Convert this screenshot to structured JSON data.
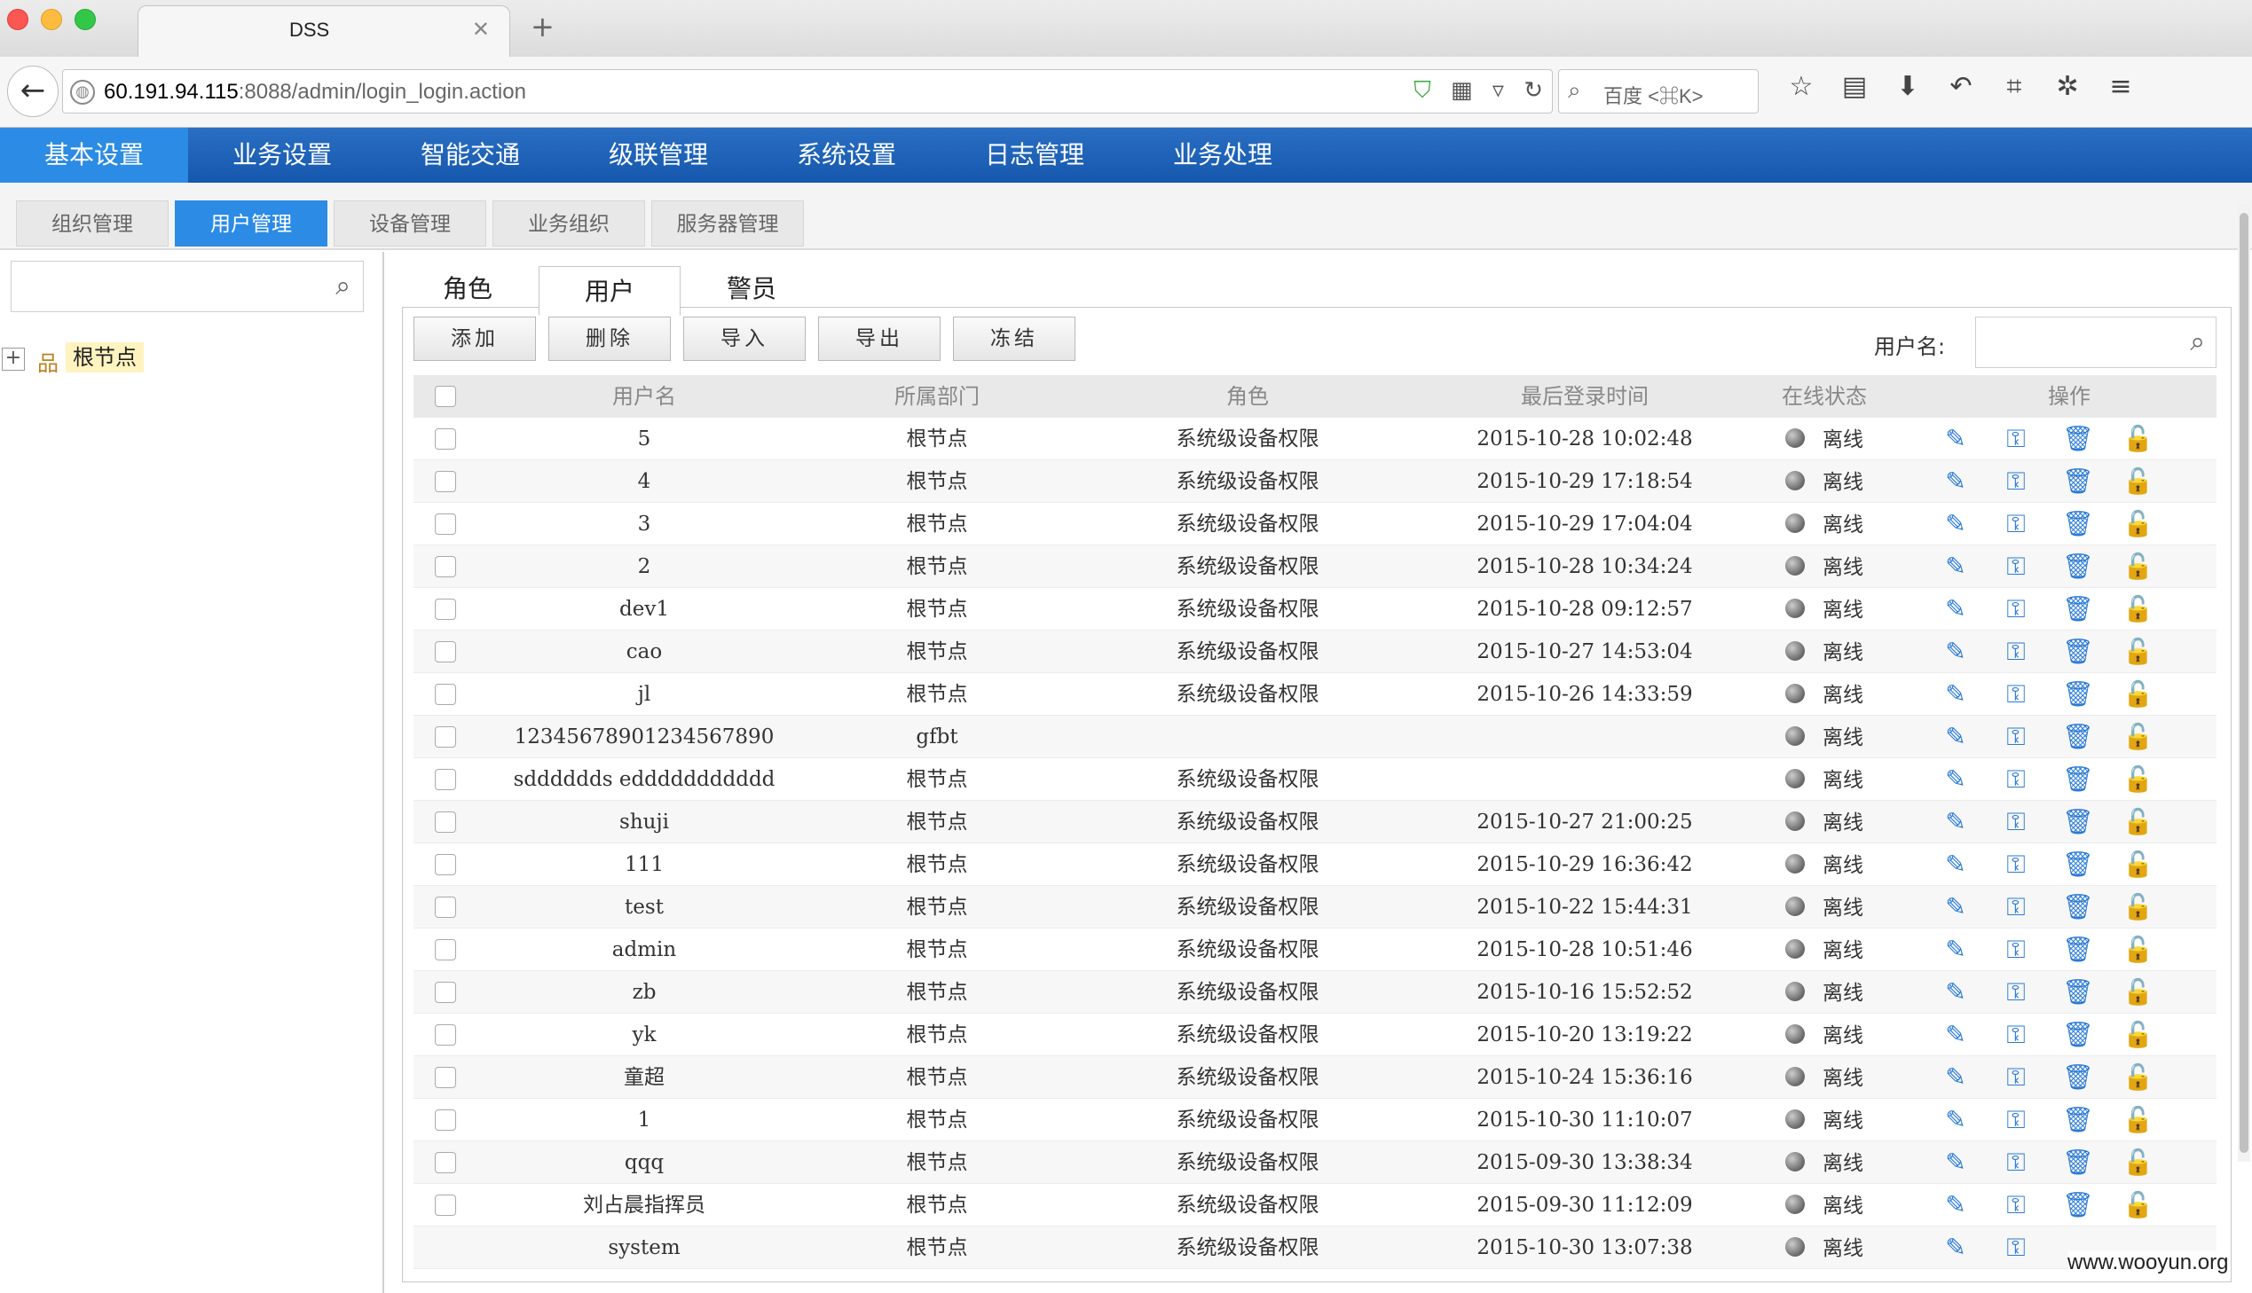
{
  "browser": {
    "tab_title": "DSS",
    "url_host": "60.191.94.115",
    "url_path": ":8088/admin/login_login.action",
    "search_placeholder": "百度 <⌘K>"
  },
  "mainnav": {
    "items": [
      "基本设置",
      "业务设置",
      "智能交通",
      "级联管理",
      "系统设置",
      "日志管理",
      "业务处理"
    ],
    "active_index": 0
  },
  "subnav": {
    "items": [
      "组织管理",
      "用户管理",
      "设备管理",
      "业务组织",
      "服务器管理"
    ],
    "active_index": 1
  },
  "tree": {
    "root_label": "根节点"
  },
  "inner_tabs": {
    "items": [
      "角色",
      "用户",
      "警员"
    ],
    "active_index": 1
  },
  "toolbar": {
    "add": "添加",
    "delete": "删除",
    "import": "导入",
    "export": "导出",
    "freeze": "冻结",
    "username_label": "用户名:"
  },
  "grid": {
    "headers": {
      "username": "用户名",
      "dept": "所属部门",
      "role": "角色",
      "last_login": "最后登录时间",
      "status": "在线状态",
      "ops": "操作"
    },
    "rows": [
      {
        "username": "5",
        "dept": "根节点",
        "role": "系统级设备权限",
        "last_login": "2015-10-28 10:02:48",
        "status": "离线"
      },
      {
        "username": "4",
        "dept": "根节点",
        "role": "系统级设备权限",
        "last_login": "2015-10-29 17:18:54",
        "status": "离线"
      },
      {
        "username": "3",
        "dept": "根节点",
        "role": "系统级设备权限",
        "last_login": "2015-10-29 17:04:04",
        "status": "离线"
      },
      {
        "username": "2",
        "dept": "根节点",
        "role": "系统级设备权限",
        "last_login": "2015-10-28 10:34:24",
        "status": "离线"
      },
      {
        "username": "dev1",
        "dept": "根节点",
        "role": "系统级设备权限",
        "last_login": "2015-10-28 09:12:57",
        "status": "离线"
      },
      {
        "username": "cao",
        "dept": "根节点",
        "role": "系统级设备权限",
        "last_login": "2015-10-27 14:53:04",
        "status": "离线"
      },
      {
        "username": "jl",
        "dept": "根节点",
        "role": "系统级设备权限",
        "last_login": "2015-10-26 14:33:59",
        "status": "离线"
      },
      {
        "username": "12345678901234567890",
        "dept": "gfbt",
        "role": "",
        "last_login": "",
        "status": "离线"
      },
      {
        "username": "sdddddds eddddddddddd",
        "dept": "根节点",
        "role": "系统级设备权限",
        "last_login": "",
        "status": "离线"
      },
      {
        "username": "shuji",
        "dept": "根节点",
        "role": "系统级设备权限",
        "last_login": "2015-10-27 21:00:25",
        "status": "离线"
      },
      {
        "username": "111",
        "dept": "根节点",
        "role": "系统级设备权限",
        "last_login": "2015-10-29 16:36:42",
        "status": "离线"
      },
      {
        "username": "test",
        "dept": "根节点",
        "role": "系统级设备权限",
        "last_login": "2015-10-22 15:44:31",
        "status": "离线"
      },
      {
        "username": "admin",
        "dept": "根节点",
        "role": "系统级设备权限",
        "last_login": "2015-10-28 10:51:46",
        "status": "离线"
      },
      {
        "username": "zb",
        "dept": "根节点",
        "role": "系统级设备权限",
        "last_login": "2015-10-16 15:52:52",
        "status": "离线"
      },
      {
        "username": "yk",
        "dept": "根节点",
        "role": "系统级设备权限",
        "last_login": "2015-10-20 13:19:22",
        "status": "离线"
      },
      {
        "username": "童超",
        "dept": "根节点",
        "role": "系统级设备权限",
        "last_login": "2015-10-24 15:36:16",
        "status": "离线"
      },
      {
        "username": "1",
        "dept": "根节点",
        "role": "系统级设备权限",
        "last_login": "2015-10-30 11:10:07",
        "status": "离线"
      },
      {
        "username": "qqq",
        "dept": "根节点",
        "role": "系统级设备权限",
        "last_login": "2015-09-30 13:38:34",
        "status": "离线"
      },
      {
        "username": "刘占晨指挥员",
        "dept": "根节点",
        "role": "系统级设备权限",
        "last_login": "2015-09-30 11:12:09",
        "status": "离线"
      },
      {
        "username": "system",
        "dept": "根节点",
        "role": "系统级设备权限",
        "last_login": "2015-10-30 13:07:38",
        "status": "离线",
        "no_checkbox": true,
        "limited_ops": true
      }
    ]
  },
  "watermark": "www.wooyun.org",
  "colors": {
    "nav_blue": "#1a5fb4",
    "active_blue": "#2c8be4",
    "icon_blue": "#2a7ad6"
  }
}
